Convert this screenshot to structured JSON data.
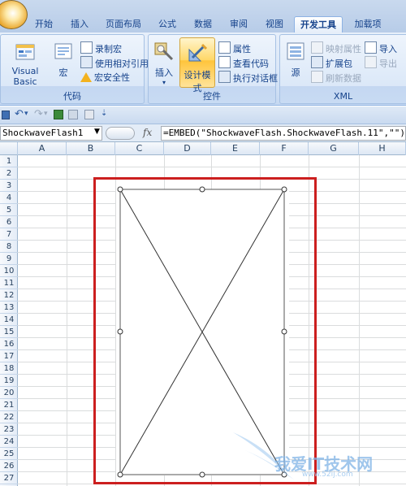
{
  "tabs": [
    {
      "label": "开始",
      "active": false
    },
    {
      "label": "插入",
      "active": false
    },
    {
      "label": "页面布局",
      "active": false
    },
    {
      "label": "公式",
      "active": false
    },
    {
      "label": "数据",
      "active": false
    },
    {
      "label": "审阅",
      "active": false
    },
    {
      "label": "视图",
      "active": false
    },
    {
      "label": "开发工具",
      "active": true
    },
    {
      "label": "加载项",
      "active": false
    }
  ],
  "ribbon": {
    "code": {
      "label": "代码",
      "visual_basic": "Visual Basic",
      "macros": "宏",
      "record_macro": "录制宏",
      "relative_ref": "使用相对引用",
      "macro_security": "宏安全性"
    },
    "controls": {
      "label": "控件",
      "insert": "插入",
      "design_mode": "设计模式",
      "properties": "属性",
      "view_code": "查看代码",
      "run_dialog": "执行对话框"
    },
    "xml": {
      "label": "XML",
      "source": "源",
      "map_props": "映射属性",
      "expansion": "扩展包",
      "refresh": "刷新数据",
      "import": "导入",
      "export": "导出"
    }
  },
  "formula_bar": {
    "name_box": "ShockwaveFlash1",
    "fx": "fx",
    "formula": "=EMBED(\"ShockwaveFlash.ShockwaveFlash.11\",\"\")"
  },
  "columns": [
    "A",
    "B",
    "C",
    "D",
    "E",
    "F",
    "G",
    "H"
  ],
  "rows": [
    "1",
    "2",
    "3",
    "4",
    "5",
    "6",
    "7",
    "8",
    "9",
    "10",
    "11",
    "12",
    "13",
    "14",
    "15",
    "16",
    "17",
    "18",
    "19",
    "20",
    "21",
    "22",
    "23",
    "24",
    "25",
    "26",
    "27"
  ],
  "watermark": "我爱IT技术网",
  "watermark_url": "www.52ij.com",
  "colors": {
    "highlight": "#cc1f1f",
    "ribbon_text": "#15428b"
  }
}
